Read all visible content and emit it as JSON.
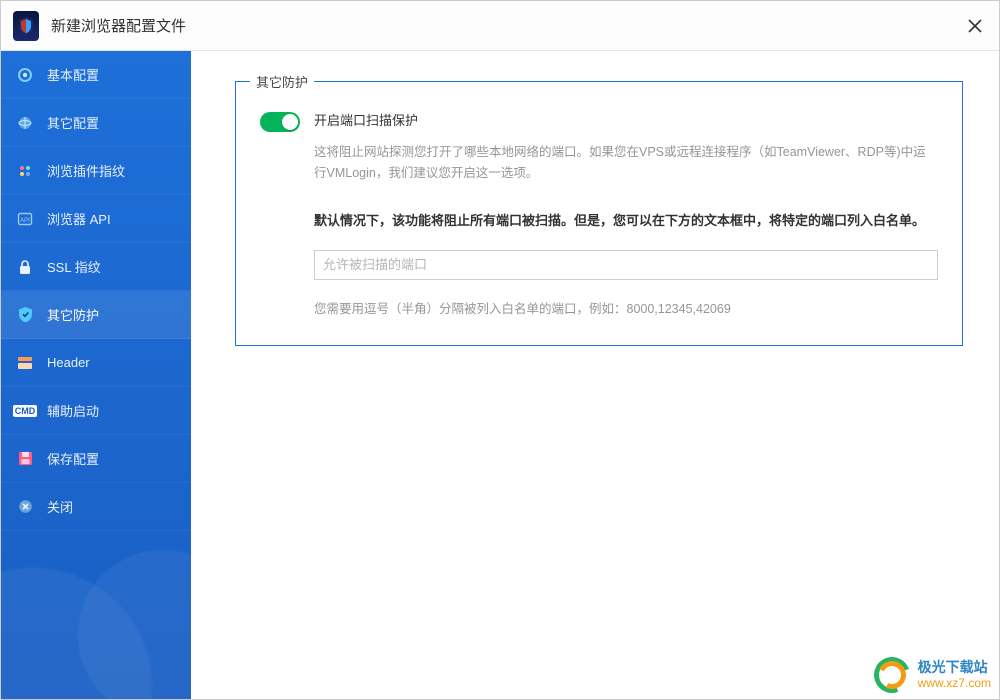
{
  "window": {
    "title": "新建浏览器配置文件"
  },
  "sidebar": {
    "items": [
      {
        "label": "基本配置"
      },
      {
        "label": "其它配置"
      },
      {
        "label": "浏览插件指纹"
      },
      {
        "label": "浏览器 API"
      },
      {
        "label": "SSL 指纹"
      },
      {
        "label": "其它防护"
      },
      {
        "label": "Header"
      },
      {
        "label": "辅助启动"
      },
      {
        "label": "保存配置"
      },
      {
        "label": "关闭"
      }
    ],
    "active_index": 5
  },
  "panel": {
    "legend": "其它防护",
    "toggle": {
      "label": "开启端口扫描保护",
      "on": true
    },
    "description": "这将阻止网站探测您打开了哪些本地网络的端口。如果您在VPS或远程连接程序（如TeamViewer、RDP等)中运行VMLogin，我们建议您开启这一选项。",
    "bold_note": "默认情况下，该功能将阻止所有端口被扫描。但是，您可以在下方的文本框中，将特定的端口列入白名单。",
    "port_input": {
      "value": "",
      "placeholder": "允许被扫描的端口"
    },
    "hint": "您需要用逗号（半角）分隔被列入白名单的端口，例如：8000,12345,42069"
  },
  "watermark": {
    "title": "极光下载站",
    "url": "www.xz7.com"
  },
  "icons": {
    "cmd_badge": "CMD"
  }
}
